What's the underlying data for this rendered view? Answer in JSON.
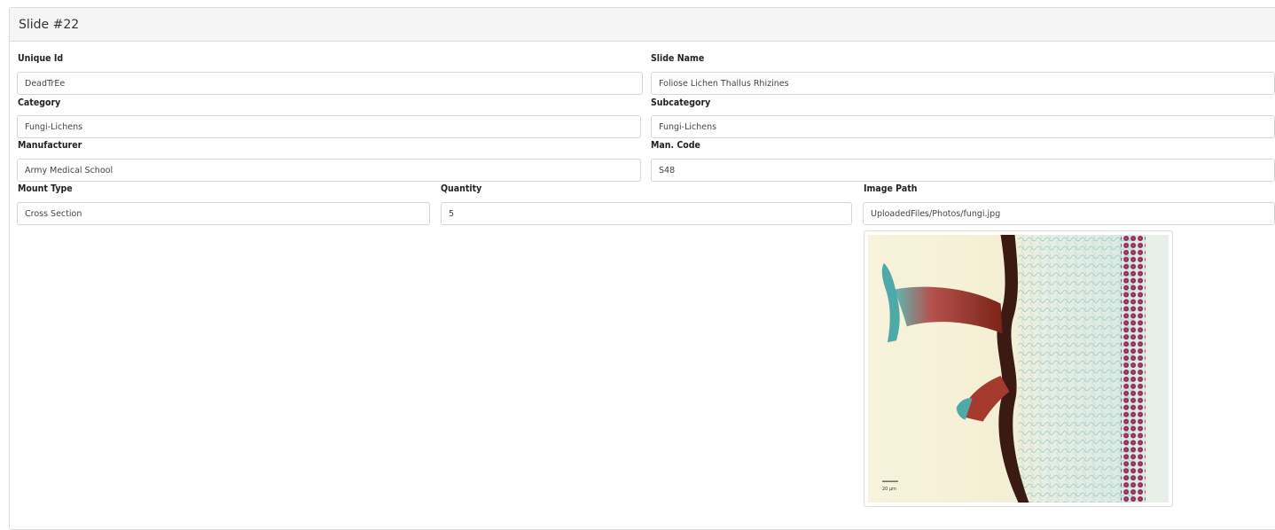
{
  "panel": {
    "title": "Slide #22"
  },
  "fields": {
    "unique_id": {
      "label": "Unique Id",
      "value": "DeadTrEe"
    },
    "slide_name": {
      "label": "Slide Name",
      "value": "Foliose Lichen Thallus Rhizines"
    },
    "category": {
      "label": "Category",
      "value": "Fungi-Lichens"
    },
    "subcategory": {
      "label": "Subcategory",
      "value": "Fungi-Lichens"
    },
    "manufacturer": {
      "label": "Manufacturer",
      "value": "Army Medical School"
    },
    "man_code": {
      "label": "Man. Code",
      "value": "S48"
    },
    "mount_type": {
      "label": "Mount Type",
      "value": "Cross Section"
    },
    "quantity": {
      "label": "Quantity",
      "value": "5"
    },
    "image_path": {
      "label": "Image Path",
      "value": "UploadedFiles/Photos/fungi.jpg"
    }
  },
  "preview": {
    "scale_bar_label": "20 µm"
  }
}
